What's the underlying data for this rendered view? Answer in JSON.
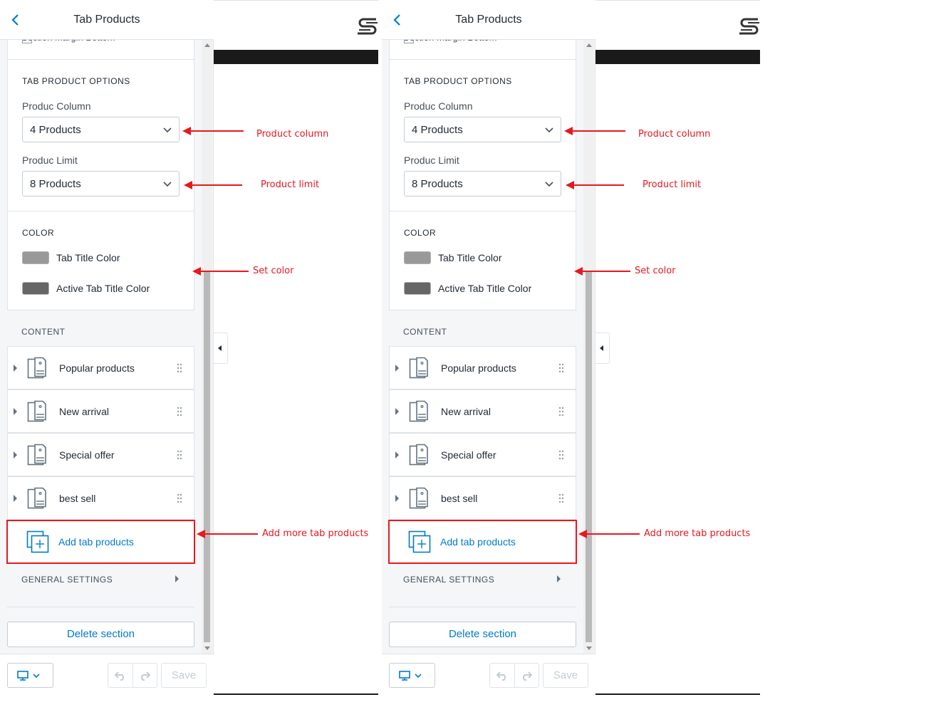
{
  "screens": [
    {
      "header": {
        "title": "Tab Products"
      },
      "cut_text": "Section Margin Bottom",
      "tab_product_options": {
        "heading": "TAB PRODUCT OPTIONS",
        "column_label": "Produc Column",
        "column_value": "4 Products",
        "limit_label": "Produc Limit",
        "limit_value": "8 Products"
      },
      "color": {
        "heading": "COLOR",
        "tab_title_color_label": "Tab Title Color",
        "tab_title_color": "#999999",
        "active_tab_title_color_label": "Active Tab Title Color",
        "active_tab_title_color": "#666666"
      },
      "content": {
        "heading": "CONTENT",
        "items": [
          {
            "label": "Popular products"
          },
          {
            "label": "New arrival"
          },
          {
            "label": "Special offer"
          },
          {
            "label": "best sell"
          }
        ],
        "add_label": "Add tab products"
      },
      "general_settings_label": "GENERAL SETTINGS",
      "delete_label": "Delete section",
      "footer": {
        "save_label": "Save"
      },
      "annotations": {
        "product_column": "Product column",
        "product_limit": "Product limit",
        "set_color": "Set color",
        "add_more": "Add more tab products"
      }
    },
    {
      "header": {
        "title": "Tab Products"
      },
      "cut_text": "Section Margin Bottom",
      "tab_product_options": {
        "heading": "TAB PRODUCT OPTIONS",
        "column_label": "Produc Column",
        "column_value": "4 Products",
        "limit_label": "Produc Limit",
        "limit_value": "8 Products"
      },
      "color": {
        "heading": "COLOR",
        "tab_title_color_label": "Tab Title Color",
        "tab_title_color": "#999999",
        "active_tab_title_color_label": "Active Tab Title Color",
        "active_tab_title_color": "#666666"
      },
      "content": {
        "heading": "CONTENT",
        "items": [
          {
            "label": "Popular products"
          },
          {
            "label": "New arrival"
          },
          {
            "label": "Special offer"
          },
          {
            "label": "best sell"
          }
        ],
        "add_label": "Add tab products"
      },
      "general_settings_label": "GENERAL SETTINGS",
      "delete_label": "Delete section",
      "footer": {
        "save_label": "Save"
      },
      "annotations": {
        "product_column": "Product column",
        "product_limit": "Product limit",
        "set_color": "Set color",
        "add_more": "Add more tab products"
      }
    }
  ],
  "colors": {
    "accent": "#007ace",
    "annotation": "#e8181f"
  },
  "icons": [
    "back-arrow-icon",
    "chevron-down-icon",
    "tab-item-icon",
    "drag-handle-icon",
    "add-tab-icon",
    "desktop-icon",
    "undo-icon",
    "redo-icon",
    "logo-icon",
    "collapse-arrow-icon"
  ]
}
